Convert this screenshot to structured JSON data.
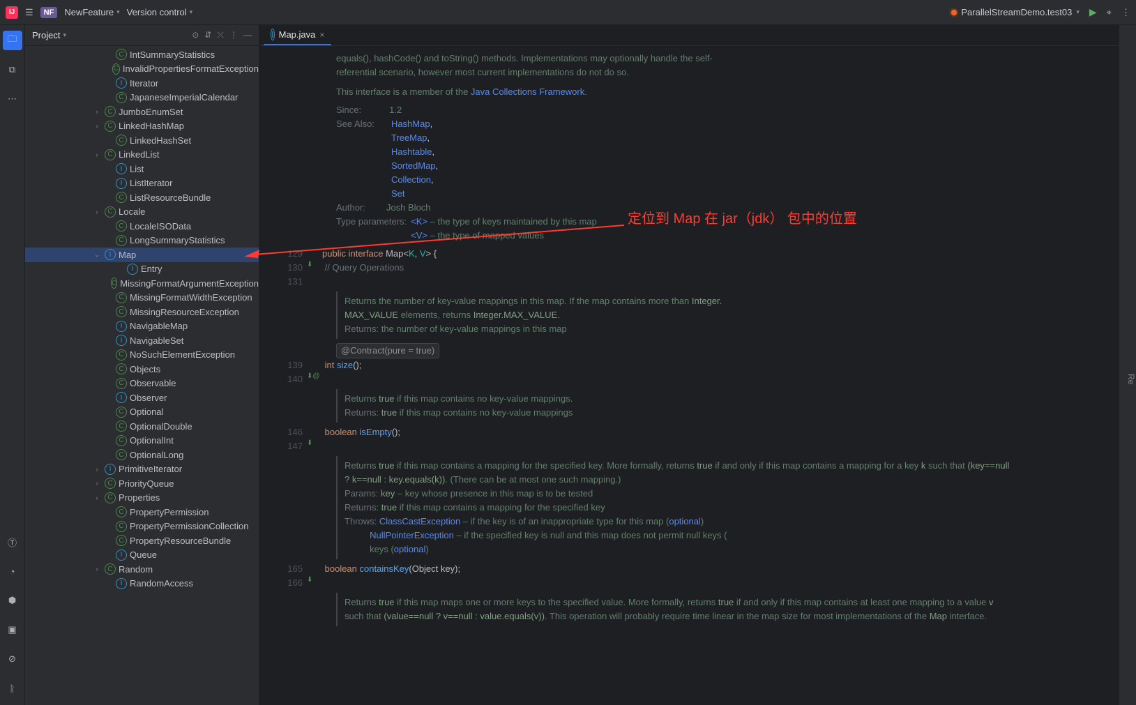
{
  "topbar": {
    "nf_badge": "NF",
    "branch": "NewFeature",
    "vcs": "Version control",
    "run_config": "ParallelStreamDemo.test03"
  },
  "project": {
    "title": "Project",
    "items": [
      {
        "indent": 7,
        "arrow": "",
        "kind": "c",
        "label": "IntSummaryStatistics"
      },
      {
        "indent": 7,
        "arrow": "",
        "kind": "c",
        "label": "InvalidPropertiesFormatException"
      },
      {
        "indent": 7,
        "arrow": "",
        "kind": "i",
        "label": "Iterator"
      },
      {
        "indent": 7,
        "arrow": "",
        "kind": "c",
        "label": "JapaneseImperialCalendar"
      },
      {
        "indent": 6,
        "arrow": "›",
        "kind": "c",
        "label": "JumboEnumSet"
      },
      {
        "indent": 6,
        "arrow": "›",
        "kind": "c",
        "label": "LinkedHashMap"
      },
      {
        "indent": 7,
        "arrow": "",
        "kind": "c",
        "label": "LinkedHashSet"
      },
      {
        "indent": 6,
        "arrow": "›",
        "kind": "c",
        "label": "LinkedList"
      },
      {
        "indent": 7,
        "arrow": "",
        "kind": "i",
        "label": "List"
      },
      {
        "indent": 7,
        "arrow": "",
        "kind": "i",
        "label": "ListIterator"
      },
      {
        "indent": 7,
        "arrow": "",
        "kind": "c",
        "label": "ListResourceBundle"
      },
      {
        "indent": 6,
        "arrow": "›",
        "kind": "c",
        "label": "Locale"
      },
      {
        "indent": 7,
        "arrow": "",
        "kind": "c",
        "label": "LocaleISOData"
      },
      {
        "indent": 7,
        "arrow": "",
        "kind": "c",
        "label": "LongSummaryStatistics"
      },
      {
        "indent": 6,
        "arrow": "⌄",
        "kind": "i",
        "label": "Map",
        "selected": true
      },
      {
        "indent": 8,
        "arrow": "",
        "kind": "i",
        "label": "Entry"
      },
      {
        "indent": 7,
        "arrow": "",
        "kind": "c",
        "label": "MissingFormatArgumentException"
      },
      {
        "indent": 7,
        "arrow": "",
        "kind": "c",
        "label": "MissingFormatWidthException"
      },
      {
        "indent": 7,
        "arrow": "",
        "kind": "c",
        "label": "MissingResourceException"
      },
      {
        "indent": 7,
        "arrow": "",
        "kind": "i",
        "label": "NavigableMap"
      },
      {
        "indent": 7,
        "arrow": "",
        "kind": "i",
        "label": "NavigableSet"
      },
      {
        "indent": 7,
        "arrow": "",
        "kind": "c",
        "label": "NoSuchElementException"
      },
      {
        "indent": 7,
        "arrow": "",
        "kind": "c",
        "label": "Objects"
      },
      {
        "indent": 7,
        "arrow": "",
        "kind": "c",
        "label": "Observable"
      },
      {
        "indent": 7,
        "arrow": "",
        "kind": "i",
        "label": "Observer"
      },
      {
        "indent": 7,
        "arrow": "",
        "kind": "c",
        "label": "Optional"
      },
      {
        "indent": 7,
        "arrow": "",
        "kind": "c",
        "label": "OptionalDouble"
      },
      {
        "indent": 7,
        "arrow": "",
        "kind": "c",
        "label": "OptionalInt"
      },
      {
        "indent": 7,
        "arrow": "",
        "kind": "c",
        "label": "OptionalLong"
      },
      {
        "indent": 6,
        "arrow": "›",
        "kind": "i",
        "label": "PrimitiveIterator"
      },
      {
        "indent": 6,
        "arrow": "›",
        "kind": "c",
        "label": "PriorityQueue"
      },
      {
        "indent": 6,
        "arrow": "›",
        "kind": "c",
        "label": "Properties"
      },
      {
        "indent": 7,
        "arrow": "",
        "kind": "c",
        "label": "PropertyPermission"
      },
      {
        "indent": 7,
        "arrow": "",
        "kind": "c",
        "label": "PropertyPermissionCollection"
      },
      {
        "indent": 7,
        "arrow": "",
        "kind": "c",
        "label": "PropertyResourceBundle"
      },
      {
        "indent": 7,
        "arrow": "",
        "kind": "i",
        "label": "Queue"
      },
      {
        "indent": 6,
        "arrow": "›",
        "kind": "c",
        "label": "Random"
      },
      {
        "indent": 7,
        "arrow": "",
        "kind": "i",
        "label": "RandomAccess"
      }
    ]
  },
  "tab": {
    "label": "Map.java"
  },
  "annotation_text": "定位到 Map 在 jar（jdk） 包中的位置",
  "doc": {
    "intro1": "equals(), hashCode() and toString() methods. Implementations may optionally handle the self-",
    "intro2": "referential scenario, however most current implementations do not do so.",
    "member": "This interface is a member of the ",
    "member_link": "Java Collections Framework",
    "since_l": "Since:",
    "since_v": "1.2",
    "see_l": "See Also:",
    "see": [
      "HashMap",
      "TreeMap",
      "Hashtable",
      "SortedMap",
      "Collection",
      "Set"
    ],
    "author_l": "Author:",
    "author_v": "Josh Bloch",
    "tparams_l": "Type parameters:",
    "tparam_k": "<K>",
    "tparam_k_d": " – the type of keys maintained by this map",
    "tparam_v": "<V>",
    "tparam_v_d": " – the type of mapped values"
  },
  "code": {
    "l129": {
      "n": "129",
      "t": "public interface Map<K, V> {"
    },
    "l130": {
      "n": "130",
      "t": "    // Query Operations"
    },
    "l131": {
      "n": "131"
    },
    "size_doc1": "Returns the number of key-value mappings in this map. If the map contains more than ",
    "size_doc_int": "Integer.MAX_VALUE",
    "size_doc2": " elements, returns ",
    "size_ret_l": "Returns:",
    "size_ret_v": " the number of key-value mappings in this map",
    "contract": "@Contract(pure = true)",
    "l139": {
      "n": "139",
      "t": "int size();"
    },
    "l140": {
      "n": "140"
    },
    "empty_doc": "Returns true if this map contains no key-value mappings.",
    "empty_ret": " if this map contains no key-value mappings",
    "l146": {
      "n": "146",
      "t": "boolean isEmpty();"
    },
    "l147": {
      "n": "147"
    },
    "ck_doc1": "Returns true if this map contains a mapping for the specified key. More formally, returns true if and only if this map contains a mapping for a key k such that (key==null ? k==null : key.equals(k)). (There can be at most one such mapping.)",
    "ck_param_l": "Params:",
    "ck_param_v": " – key whose presence in this map is to be tested",
    "ck_ret": " if this map contains a mapping for the specified key",
    "ck_throw_l": "Throws:",
    "ck_throw1": "ClassCastException",
    "ck_throw1_d": " – if the key is of an inappropriate type for this map (",
    "opt": "optional",
    "ck_throw2": "NullPointerException",
    "ck_throw2_d": " – if the specified key is null and this map does not permit null keys (",
    "l165": {
      "n": "165",
      "t": "boolean containsKey(Object key);"
    },
    "l166": {
      "n": "166"
    },
    "cv_doc": "Returns true if this map maps one or more keys to the specified value. More formally, returns true if and only if this map contains at least one mapping to a value v such that (value==null ? v==null : value.equals(v)). This operation will probably require time linear in the map size for most implementations of the Map interface."
  }
}
